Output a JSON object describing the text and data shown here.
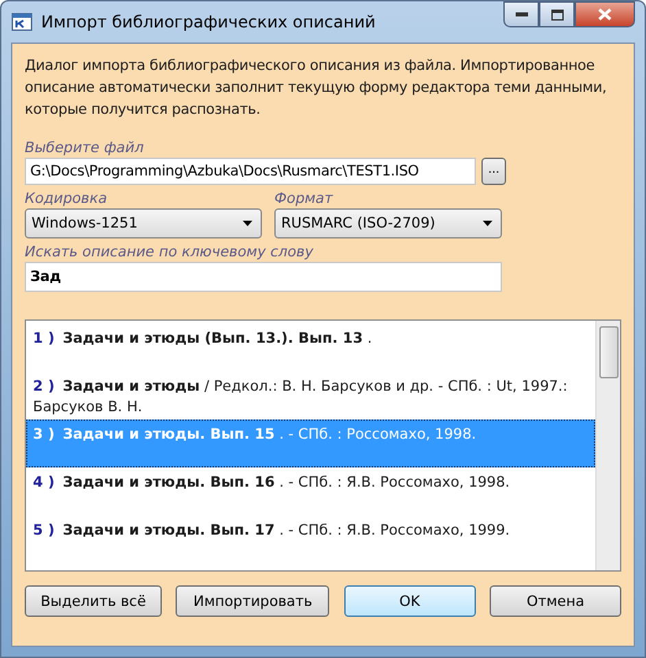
{
  "window": {
    "title": "Импорт библиографических описаний"
  },
  "description": "Диалог импорта библиографического описания из файла. Импортированное описание автоматически заполнит текущую форму редактора теми данными, которые получится распознать.",
  "file": {
    "label": "Выберите файл",
    "value": "G:\\Docs\\Programming\\Azbuka\\Docs\\Rusmarc\\TEST1.ISO",
    "browse": "..."
  },
  "encoding": {
    "label": "Кодировка",
    "value": "Windows-1251"
  },
  "format": {
    "label": "Формат",
    "value": "RUSMARC (ISO-2709)"
  },
  "search": {
    "label": "Искать описание по ключевому слову",
    "value": "Зад"
  },
  "results": [
    {
      "number": "1 )",
      "text": "**Задачи и этюды (Вып. 13.). Вып. 13** .",
      "selected": false
    },
    {
      "number": "2 )",
      "text": "**Задачи и этюды**  / Редкол.: В. Н. Барсуков и др. - СПб. : Ut, 1997.: Барсуков В. Н.",
      "selected": false
    },
    {
      "number": "3 )",
      "text": "**Задачи и этюды. Вып. 15** . - СПб. : Россомахо, 1998.",
      "selected": true
    },
    {
      "number": "4 )",
      "text": "**Задачи и этюды. Вып. 16** . - СПб. : Я.В. Россомахо, 1998.",
      "selected": false
    },
    {
      "number": "5 )",
      "text": "**Задачи и этюды. Вып. 17** . - СПб. : Я.В. Россомахо, 1999.",
      "selected": false
    }
  ],
  "buttons": [
    {
      "label": "Выделить всё",
      "default": false
    },
    {
      "label": "Импортировать",
      "default": false
    },
    {
      "label": "OK",
      "default": true
    },
    {
      "label": "Отмена",
      "default": false
    }
  ]
}
